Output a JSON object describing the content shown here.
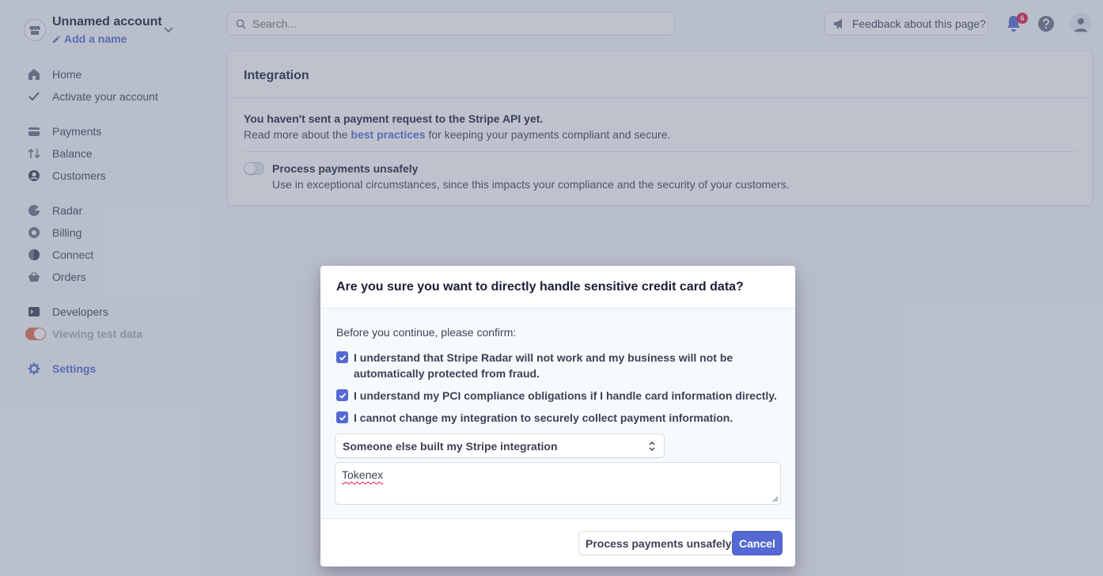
{
  "account": {
    "name": "Unnamed account",
    "add_name": "Add a name"
  },
  "search": {
    "placeholder": "Search..."
  },
  "topbar": {
    "feedback": "Feedback about this page?",
    "notification_count": "6"
  },
  "nav": {
    "home": "Home",
    "activate": "Activate your account",
    "payments": "Payments",
    "balance": "Balance",
    "customers": "Customers",
    "radar": "Radar",
    "billing": "Billing",
    "connect": "Connect",
    "orders": "Orders",
    "developers": "Developers",
    "test_data": "Viewing test data",
    "settings": "Settings"
  },
  "card": {
    "title": "Integration",
    "warning": "You haven't sent a payment request to the Stripe API yet.",
    "read_prefix": "Read more about the ",
    "read_link": "best practices",
    "read_suffix": " for keeping your payments compliant and secure.",
    "option_title": "Process payments unsafely",
    "option_desc": "Use in exceptional circumstances, since this impacts your compliance and the security of your customers."
  },
  "modal": {
    "title": "Are you sure you want to directly handle sensitive credit card data?",
    "intro": "Before you continue, please confirm:",
    "check1": "I understand that Stripe Radar will not work and my business will not be automatically protected from fraud.",
    "check2": "I understand my PCI compliance obligations if I handle card information directly.",
    "check3": "I cannot change my integration to securely collect payment information.",
    "select_value": "Someone else built my Stripe integration",
    "textarea_value": "Tokenex",
    "btn_unsafe": "Process payments unsafely",
    "btn_cancel": "Cancel"
  },
  "colors": {
    "accent": "#5469d4",
    "test_toggle": "#e56f4a",
    "badge": "#df1b41"
  }
}
